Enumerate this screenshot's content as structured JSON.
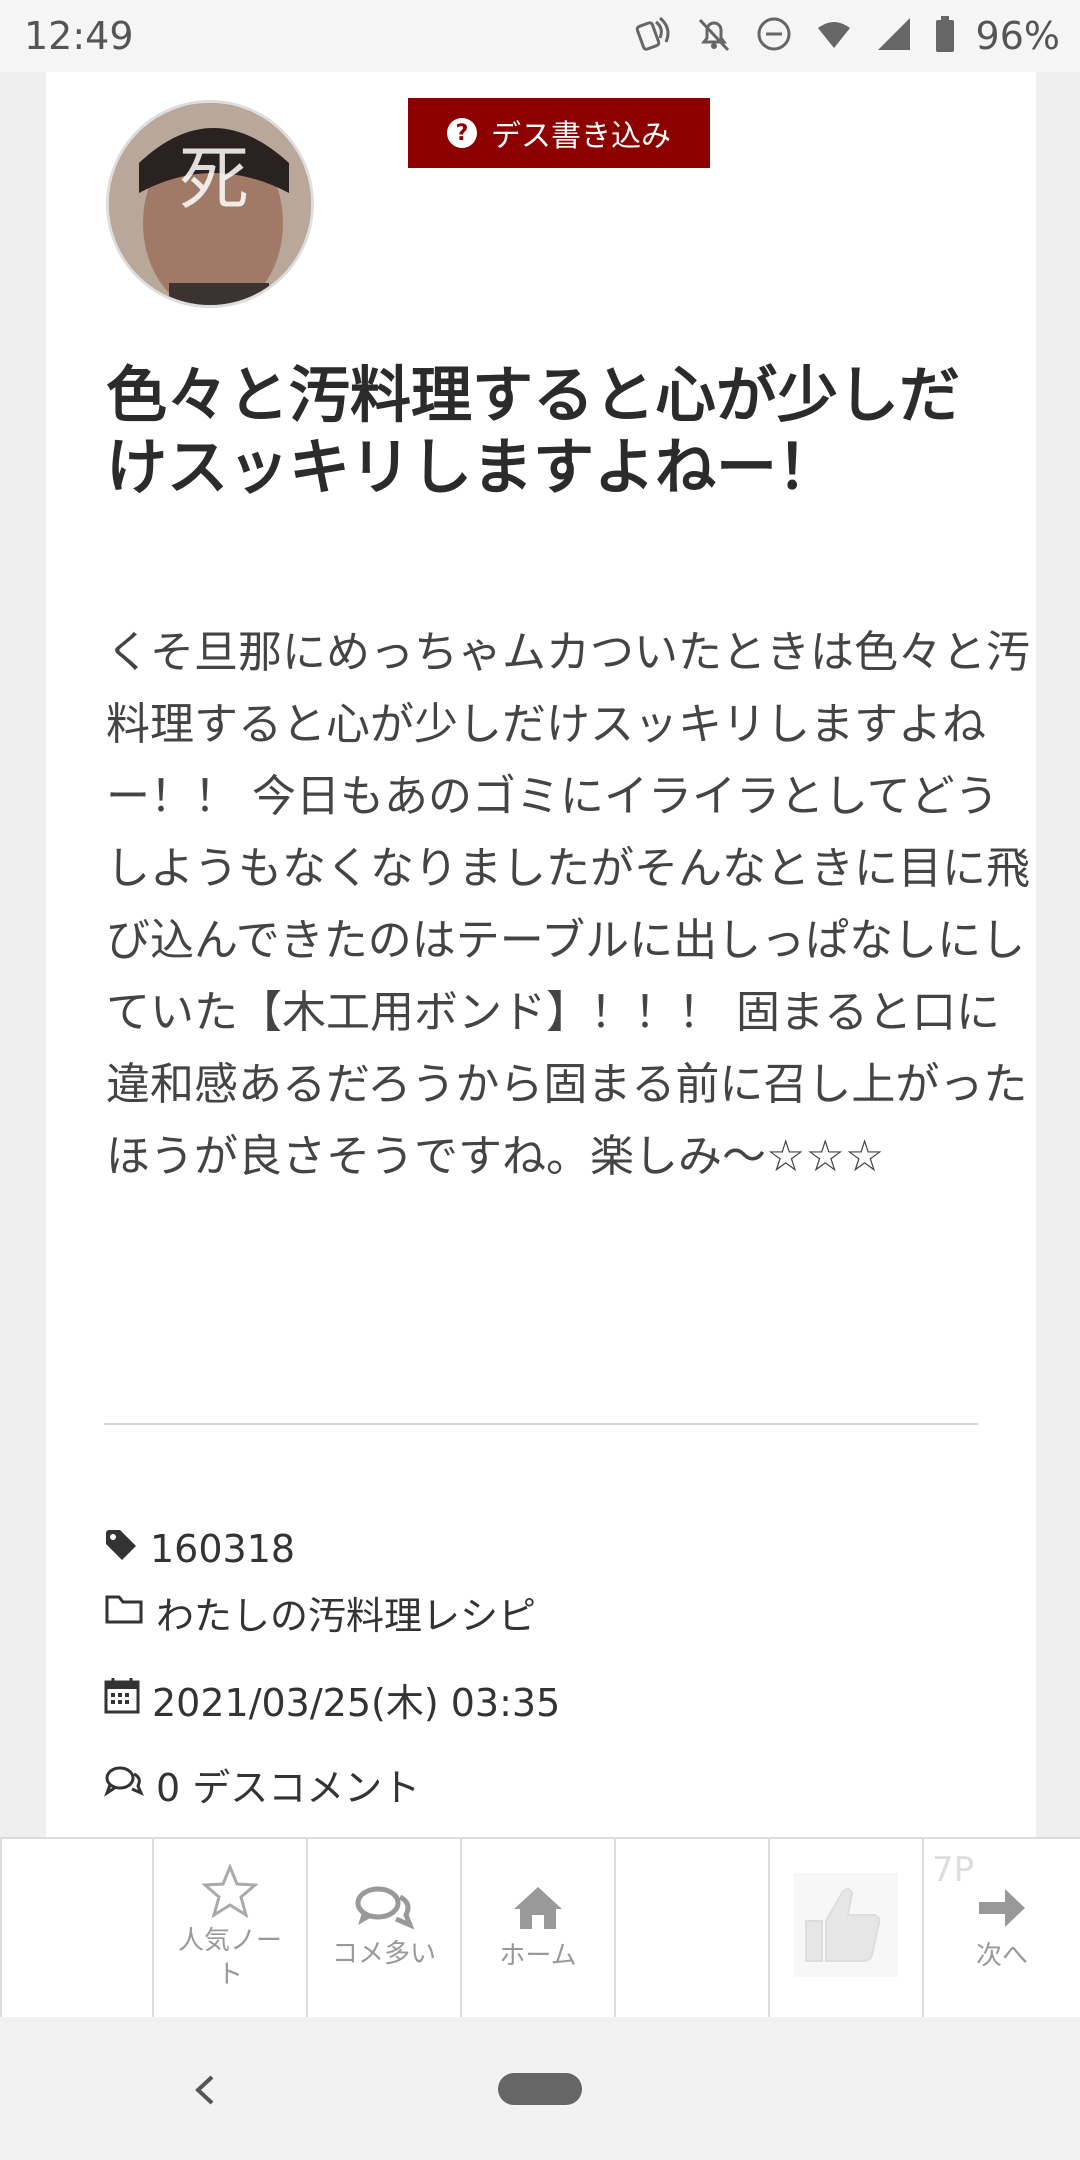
{
  "status_bar": {
    "time": "12:49",
    "battery": "96%"
  },
  "post": {
    "avatar_text": "死",
    "death_button_label": "デス書き込み",
    "title": "色々と汚料理すると心が少しだけスッキリしますよねー！",
    "body": "くそ旦那にめっちゃムカついたときは色々と汚料理すると心が少しだけスッキリしますよねー！！ 今日もあのゴミにイライラとしてどうしようもなくなりましたがそんなときに目に飛び込んできたのはテーブルに出しっぱなしにしていた【木工用ボンド】！！！ 固まると口に違和感あるだろうから固まる前に召し上がったほうが良さそうですね。楽しみ〜☆☆☆",
    "tag": "160318",
    "category": "わたしの汚料理レシピ",
    "date": "2021/03/25(木) 03:35",
    "comments": "0 デスコメント"
  },
  "bottom_nav": {
    "popular": "人気ノート",
    "comments_many": "コメ多い",
    "home": "ホーム",
    "next_page_badge": "7P",
    "next": "次へ"
  },
  "colors": {
    "accent": "#8c0000",
    "background": "#efefef",
    "card": "#ffffff"
  }
}
